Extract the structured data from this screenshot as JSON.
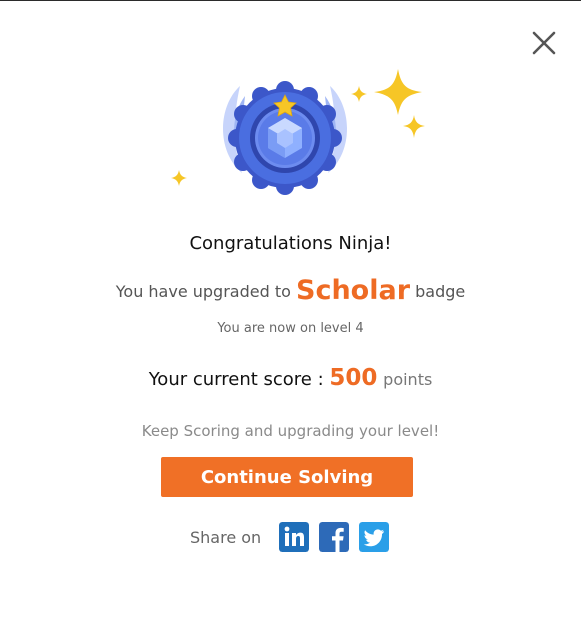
{
  "dialog": {
    "congrats_text": "Congratulations Ninja!",
    "upgraded_prefix": "You have upgraded to",
    "badge_name": "Scholar",
    "upgraded_suffix": "badge",
    "level_text": "You are now on level 4",
    "score_prefix": "Your current score :",
    "score_value": "500",
    "score_unit": "points",
    "keep_text": "Keep Scoring and upgrading your level!",
    "continue_label": "Continue Solving",
    "share_label": "Share on"
  },
  "colors": {
    "accent_orange": "#ee6b24",
    "button_orange": "#f07026",
    "badge_blue": "#4a6ee0",
    "sparkle_yellow": "#f6c626",
    "linkedin": "#1f6fba",
    "facebook": "#2d6ab8",
    "twitter": "#2a9fe8"
  },
  "icons": {
    "close": "close-icon",
    "badge": "scholar-badge-icon",
    "linkedin": "linkedin-icon",
    "facebook": "facebook-icon",
    "twitter": "twitter-icon"
  }
}
